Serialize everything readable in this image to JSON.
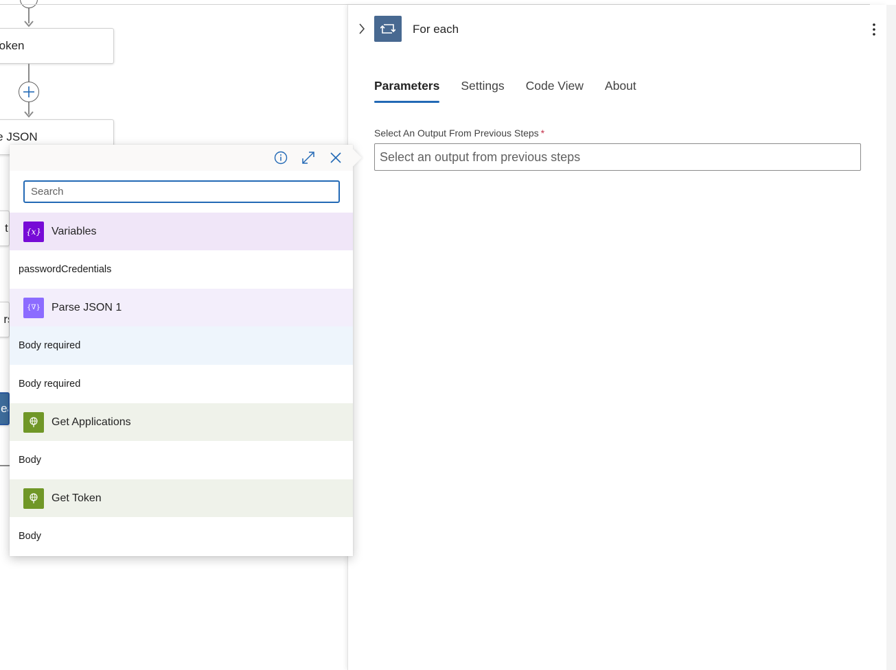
{
  "canvas": {
    "nodes": {
      "get_token_partial": "t Token",
      "parse_json_partial": "rse JSON",
      "partial_a": "t A",
      "partial_rse": "rse",
      "partial_ea": "ea"
    }
  },
  "popup": {
    "search_placeholder": "Search",
    "groups": [
      {
        "title": "Variables",
        "icon": "variables-icon",
        "items": [
          "passwordCredentials"
        ]
      },
      {
        "title": "Parse JSON 1",
        "icon": "parse-json-icon",
        "items": [
          "Body required",
          "Body required"
        ]
      },
      {
        "title": "Get Applications",
        "icon": "http-globe-icon",
        "items": [
          "Body"
        ]
      },
      {
        "title": "Get Token",
        "icon": "http-globe-icon",
        "items": [
          "Body"
        ]
      }
    ]
  },
  "panel": {
    "title": "For each",
    "tabs": [
      "Parameters",
      "Settings",
      "Code View",
      "About"
    ],
    "active_tab": "Parameters",
    "field_label": "Select An Output From Previous Steps",
    "field_required_mark": "*",
    "field_placeholder": "Select an output from previous steps"
  },
  "colors": {
    "accent": "#2269b5",
    "foreach_icon_bg": "#486991",
    "variables_icon_bg": "#770bd6",
    "parse_json_icon_bg": "#8c6cff",
    "http_icon_bg": "#709727"
  }
}
